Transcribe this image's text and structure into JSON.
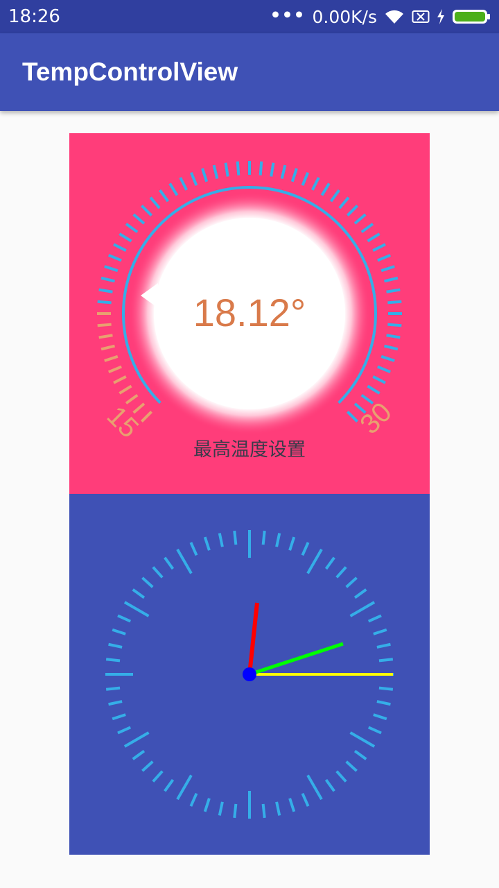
{
  "status_bar": {
    "time": "18:26",
    "network_speed": "0.00K/s",
    "icons": [
      "more-dots-icon",
      "wifi-icon",
      "sim-disabled-icon",
      "charging-bolt-icon",
      "battery-icon"
    ]
  },
  "app_bar": {
    "title": "TempControlView"
  },
  "temp_control": {
    "value": "18.12°",
    "min_label": "15",
    "max_label": "30",
    "caption": "最高温度设置",
    "colors": {
      "background": "#ff3d7a",
      "tick_active": "#e8a070",
      "tick_inactive": "#35aee8",
      "arc": "#35aee8",
      "value_text": "#d97a4a",
      "knob": "#ffffff"
    }
  },
  "clock": {
    "hour_hand_color": "#ff0000",
    "minute_hand_color": "#00ff00",
    "second_hand_color": "#ffff00",
    "center_color": "#0000ff",
    "tick_color": "#35aee8",
    "background": "#3f51b5"
  }
}
